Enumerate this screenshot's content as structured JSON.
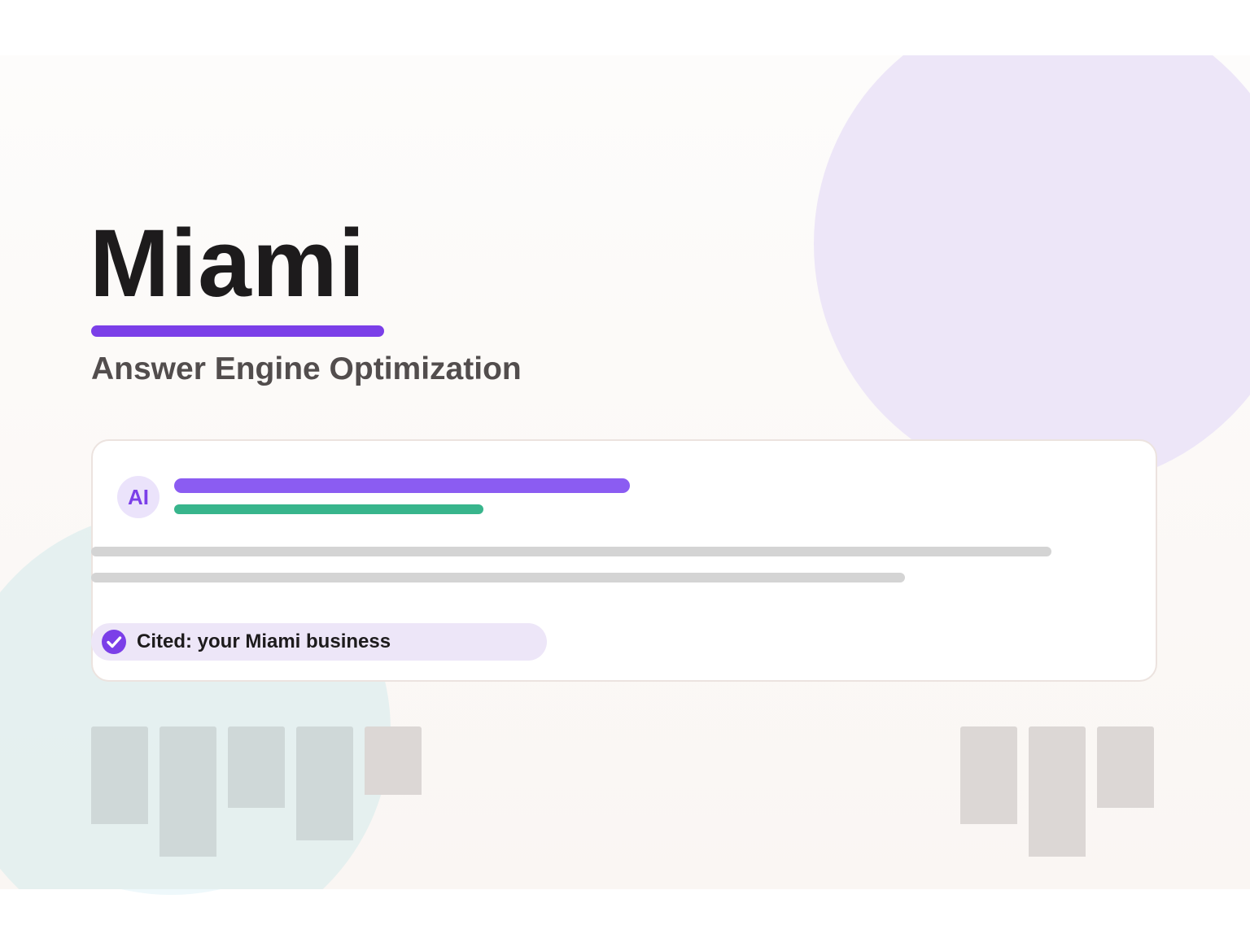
{
  "hero": {
    "title": "Miami",
    "subtitle": "Answer Engine Optimization"
  },
  "card": {
    "avatar_label": "AI",
    "cited_label": "Cited: your Miami business",
    "check_icon": "check-circle-icon"
  },
  "colors": {
    "accent": "#7b3fe8",
    "accent_light": "#8b5cf2",
    "green": "#38b58c",
    "text_dark": "#1d1b1c",
    "text_muted": "#524d4d",
    "decor_purple": "#ede6f8",
    "decor_teal": "#deeeee"
  }
}
